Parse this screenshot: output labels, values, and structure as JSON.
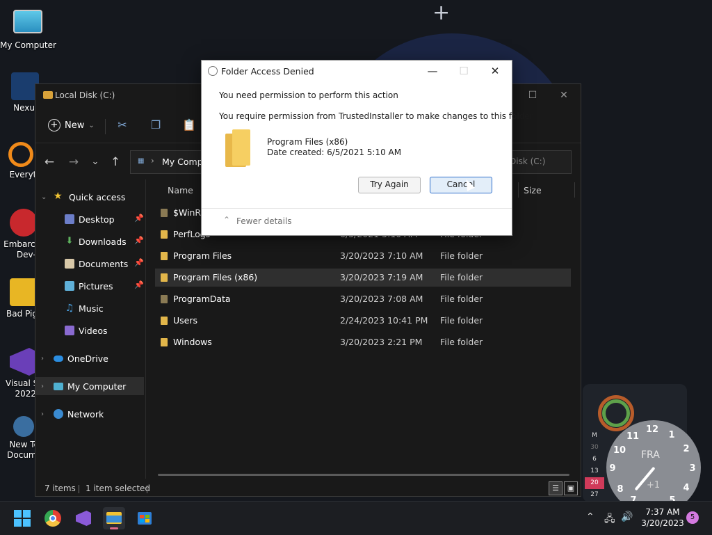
{
  "desktop": {
    "icons": [
      {
        "label": "My Computer"
      },
      {
        "label": "Nexu"
      },
      {
        "label": "Everyth"
      },
      {
        "label": "Embarca",
        "label2": "Dev-C"
      },
      {
        "label": "Bad Pig"
      },
      {
        "label": "Visual St",
        "label2": "2022"
      },
      {
        "label": "New Te",
        "label2": "Docume"
      }
    ]
  },
  "explorer": {
    "title": "Local Disk (C:)",
    "toolbar": {
      "new_label": "New"
    },
    "address": {
      "path": "My Compu"
    },
    "search": {
      "placeholder": "Disk (C:)"
    },
    "sidebar": {
      "quick_access": "Quick access",
      "items": [
        {
          "label": "Desktop",
          "color": "#6c7ec9"
        },
        {
          "label": "Downloads",
          "color": "#5fb35f"
        },
        {
          "label": "Documents",
          "color": "#d8c8a8"
        },
        {
          "label": "Pictures",
          "color": "#5fb0d8"
        },
        {
          "label": "Music",
          "color": "#4aa0e0"
        },
        {
          "label": "Videos",
          "color": "#8a6ad0"
        }
      ],
      "onedrive": "OneDrive",
      "my_computer": "My Computer",
      "network": "Network"
    },
    "columns": {
      "name": "Name",
      "size": "Size"
    },
    "rows": [
      {
        "name": "$WinRE",
        "date": "",
        "type": ""
      },
      {
        "name": "PerfLogs",
        "date": "6/5/2021 5:10 AM",
        "type": "File folder"
      },
      {
        "name": "Program Files",
        "date": "3/20/2023 7:10 AM",
        "type": "File folder"
      },
      {
        "name": "Program Files (x86)",
        "date": "3/20/2023 7:19 AM",
        "type": "File folder"
      },
      {
        "name": "ProgramData",
        "date": "3/20/2023 7:08 AM",
        "type": "File folder"
      },
      {
        "name": "Users",
        "date": "2/24/2023 10:41 PM",
        "type": "File folder"
      },
      {
        "name": "Windows",
        "date": "3/20/2023 2:21 PM",
        "type": "File folder"
      }
    ],
    "status": {
      "count": "7 items",
      "selected": "1 item selected"
    }
  },
  "dialog": {
    "title": "Folder Access Denied",
    "line1": "You need permission to perform this action",
    "line2": "You require permission from TrustedInstaller to make changes to this folder",
    "folder_name": "Program Files (x86)",
    "date_created": "Date created: 6/5/2021 5:10 AM",
    "try_again": "Try Again",
    "cancel": "Cancel",
    "fewer_details": "Fewer details"
  },
  "widgets": {
    "calendar": [
      "M",
      "30",
      "6",
      "13",
      "20",
      "27"
    ],
    "calendar_today": "20",
    "clock_brand": "FRA",
    "clock_plus": "+1",
    "clock_numbers": [
      "12",
      "1",
      "2",
      "3",
      "4",
      "5",
      "7",
      "8",
      "9",
      "10",
      "11"
    ]
  },
  "taskbar": {
    "time": "7:37 AM",
    "date": "3/20/2023",
    "notifications": "5"
  }
}
